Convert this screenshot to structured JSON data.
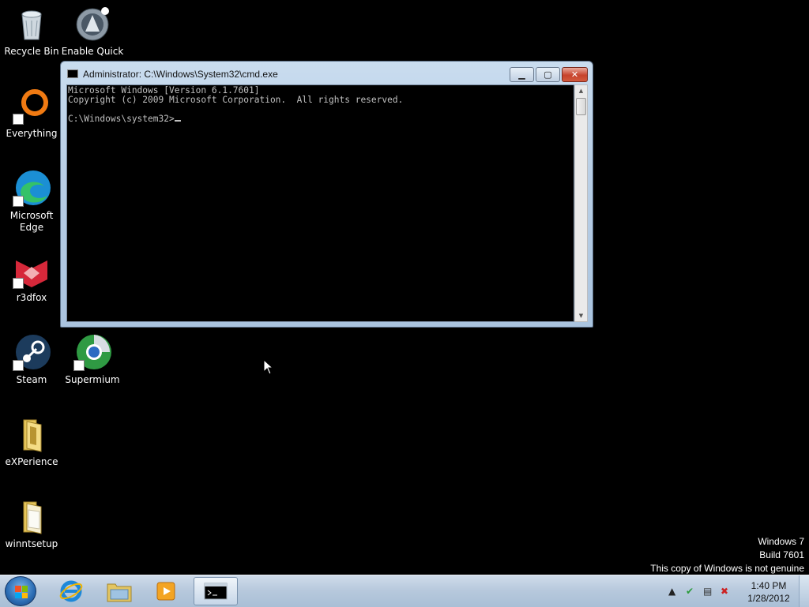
{
  "desktop": {
    "icons": [
      {
        "label": "Recycle Bin",
        "icon": "recycle-bin-icon"
      },
      {
        "label": "Enable Quick",
        "icon": "aimp-icon"
      },
      {
        "label": "Everything",
        "icon": "everything-search-icon"
      },
      {
        "label": "Microsoft Edge",
        "icon": "edge-icon"
      },
      {
        "label": "r3dfox",
        "icon": "r3dfox-icon"
      },
      {
        "label": "Steam",
        "icon": "steam-icon"
      },
      {
        "label": "Supermium",
        "icon": "supermium-icon"
      },
      {
        "label": "eXPerience",
        "icon": "folder-icon"
      },
      {
        "label": "winntsetup",
        "icon": "folder-icon"
      }
    ]
  },
  "cmd_window": {
    "title": "Administrator: C:\\Windows\\System32\\cmd.exe",
    "buttons": {
      "minimize": "minimize",
      "maximize": "maximize",
      "close": "close"
    },
    "lines": [
      "Microsoft Windows [Version 6.1.7601]",
      "Copyright (c) 2009 Microsoft Corporation.  All rights reserved.",
      "",
      "C:\\Windows\\system32>"
    ]
  },
  "watermark": {
    "line1": "Windows 7",
    "line2": "Build 7601",
    "line3": "This copy of Windows is not genuine"
  },
  "taskbar": {
    "pinned": [
      "internet-explorer-icon",
      "file-explorer-icon",
      "media-player-icon",
      "cmd-icon"
    ],
    "active_index": 3,
    "clock": {
      "time": "1:40 PM",
      "date": "1/28/2012"
    }
  },
  "colors": {
    "desktop_bg": "#000000",
    "console_text": "#c0c0c0",
    "close_button": "#c7432c"
  }
}
